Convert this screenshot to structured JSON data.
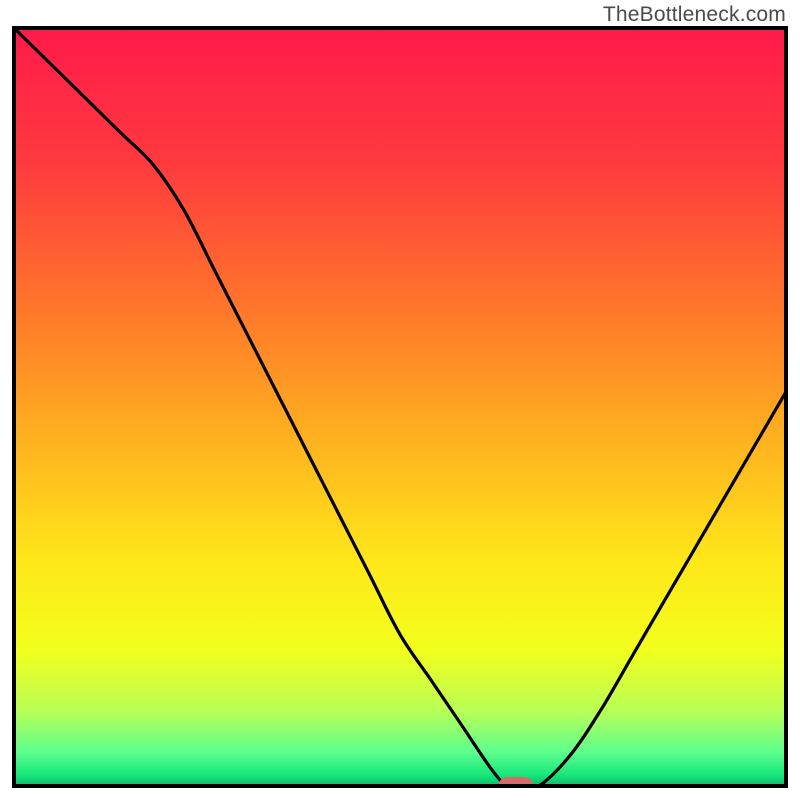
{
  "watermark": "TheBottleneck.com",
  "chart_data": {
    "type": "line",
    "title": "",
    "xlabel": "",
    "ylabel": "",
    "xlim": [
      0,
      100
    ],
    "ylim": [
      0,
      100
    ],
    "x": [
      0,
      5,
      10,
      14,
      18,
      22,
      26,
      30,
      34,
      38,
      42,
      46,
      50,
      54,
      58,
      62,
      64,
      66,
      68,
      72,
      76,
      80,
      84,
      88,
      92,
      96,
      100
    ],
    "values": [
      100,
      95,
      90,
      86,
      82,
      76,
      68,
      60,
      52,
      44,
      36,
      28,
      20,
      14,
      8,
      2,
      0,
      0,
      0,
      4,
      10,
      17,
      24,
      31,
      38,
      45,
      52
    ],
    "gradient_stops": [
      {
        "offset": 0.0,
        "color": "#ff1a4b"
      },
      {
        "offset": 0.18,
        "color": "#ff3a3e"
      },
      {
        "offset": 0.38,
        "color": "#ff7a2a"
      },
      {
        "offset": 0.55,
        "color": "#ffb41f"
      },
      {
        "offset": 0.7,
        "color": "#ffe61a"
      },
      {
        "offset": 0.82,
        "color": "#f3ff1c"
      },
      {
        "offset": 0.9,
        "color": "#b9ff55"
      },
      {
        "offset": 0.955,
        "color": "#5eff8e"
      },
      {
        "offset": 0.985,
        "color": "#17e87a"
      },
      {
        "offset": 1.0,
        "color": "#0fb86b"
      }
    ],
    "marker": {
      "x": 65,
      "y": 0,
      "color": "#d46a6a",
      "rx": 10
    },
    "line_color": "#000000",
    "border_color": "#000000"
  }
}
